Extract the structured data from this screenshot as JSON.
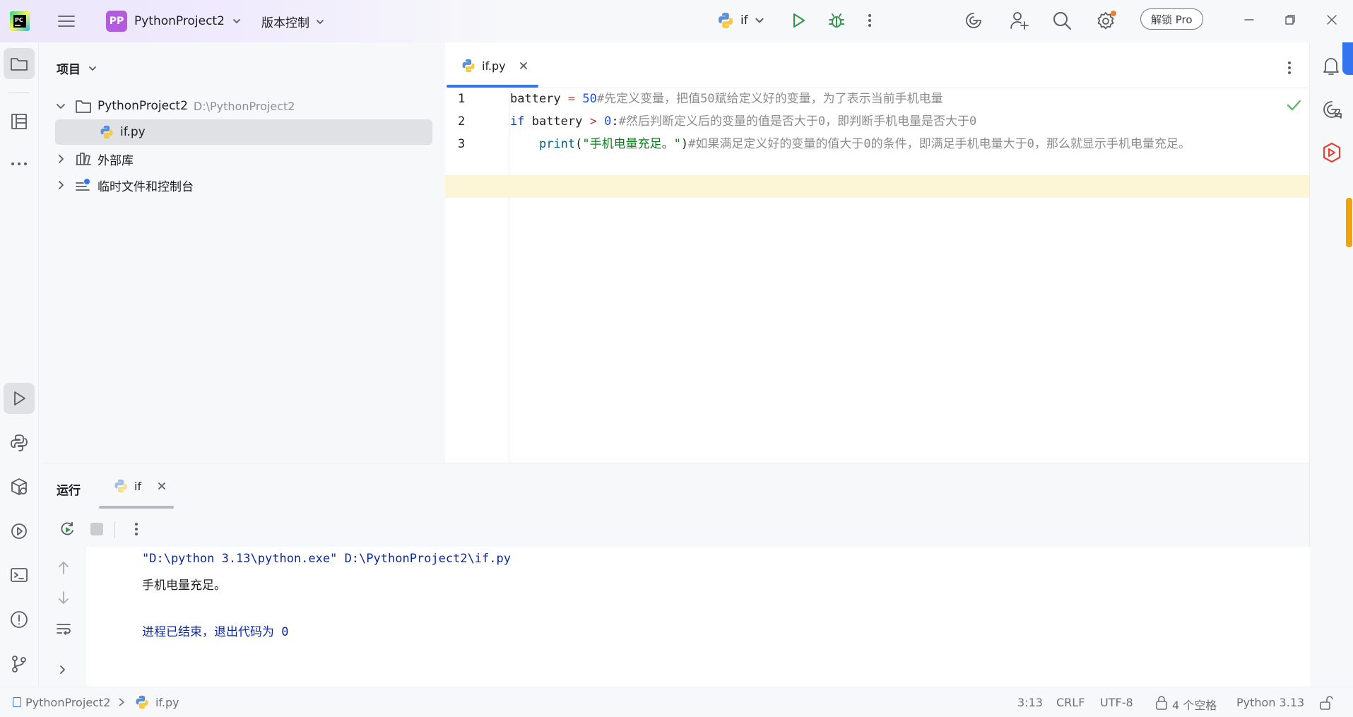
{
  "titlebar": {
    "project_badge": "PP",
    "project_name": "PythonProject2",
    "vcs_label": "版本控制",
    "run_config": "if",
    "pro_button": "解锁 Pro"
  },
  "project_panel": {
    "title": "项目",
    "tree": [
      {
        "label": "PythonProject2",
        "path": "D:\\PythonProject2"
      },
      {
        "label": "if.py"
      },
      {
        "label": "外部库"
      },
      {
        "label": "临时文件和控制台"
      }
    ]
  },
  "editor": {
    "tab_label": "if.py",
    "lines": [
      {
        "no": "1",
        "tokens": [
          {
            "t": "battery ",
            "c": "var"
          },
          {
            "t": "= ",
            "c": "op"
          },
          {
            "t": "50",
            "c": "num"
          },
          {
            "t": "#先定义变量，把值50赋给定义好的变量，为了表示当前手机电量",
            "c": "cm"
          }
        ]
      },
      {
        "no": "2",
        "tokens": [
          {
            "t": "if ",
            "c": "kw"
          },
          {
            "t": "battery ",
            "c": "var"
          },
          {
            "t": "> ",
            "c": "op"
          },
          {
            "t": "0",
            "c": "num"
          },
          {
            "t": ":",
            "c": "var"
          },
          {
            "t": "#然后判断定义后的变量的值是否大于0，即判断手机电量是否大于0",
            "c": "cm"
          }
        ]
      },
      {
        "no": "3",
        "tokens": [
          {
            "t": "    ",
            "c": "var"
          },
          {
            "t": "print",
            "c": "fn"
          },
          {
            "t": "(",
            "c": "var"
          },
          {
            "t": "\"手机电量充足。\"",
            "c": "str"
          },
          {
            "t": ")",
            "c": "var"
          },
          {
            "t": "#如果满足定义好的变量的值大于0的条件，即满足手机电量大于0，那么就显示手机电量充足。",
            "c": "cm"
          }
        ]
      }
    ]
  },
  "run_panel": {
    "title": "运行",
    "tab_label": "if",
    "console": [
      "\"D:\\python 3.13\\python.exe\" D:\\PythonProject2\\if.py",
      "手机电量充足。",
      "",
      "进程已结束，退出代码为 0"
    ]
  },
  "statusbar": {
    "breadcrumb_project": "PythonProject2",
    "breadcrumb_file": "if.py",
    "position": "3:13",
    "line_ending": "CRLF",
    "encoding": "UTF-8",
    "indent": "4 个空格",
    "interpreter": "Python 3.13"
  },
  "colors": {
    "accent": "#3574f0",
    "current_line": "#fcf5d6",
    "run_green": "#369650",
    "check_green": "#5fb865"
  }
}
